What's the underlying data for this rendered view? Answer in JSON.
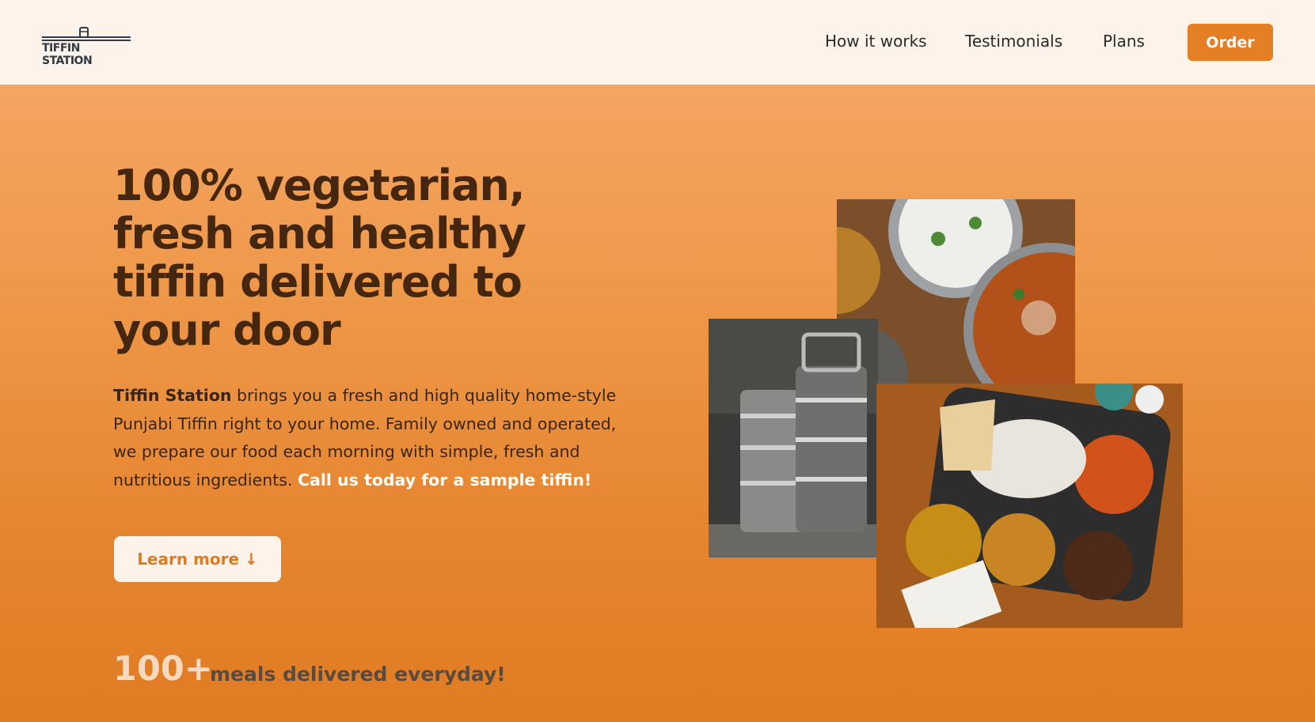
{
  "header": {
    "logo_text": "TIFFIN STATION",
    "nav": [
      {
        "label": "How it works"
      },
      {
        "label": "Testimonials"
      },
      {
        "label": "Plans"
      }
    ],
    "order_label": "Order"
  },
  "hero": {
    "headline": "100% vegetarian, fresh and healthy tiffin delivered to your door",
    "desc_brand": "Tiffin Station",
    "desc_body": " brings you a fresh and high quality home-style Punjabi Tiffin right to your home. Family owned and operated, we prepare our food each morning with simple, fresh and nutritious ingredients. ",
    "desc_cta": "Call us today for a sample tiffin!",
    "learn_more_label": "Learn more ↓",
    "stat_number": "100+",
    "stat_label": "meals delivered everyday!"
  },
  "colors": {
    "accent": "#e47f25",
    "header_bg": "#fdf3ea",
    "headline": "#45260f"
  },
  "images": [
    {
      "name": "curry-rice-photo"
    },
    {
      "name": "tiffin-carrier-photo"
    },
    {
      "name": "thali-platter-photo"
    }
  ]
}
